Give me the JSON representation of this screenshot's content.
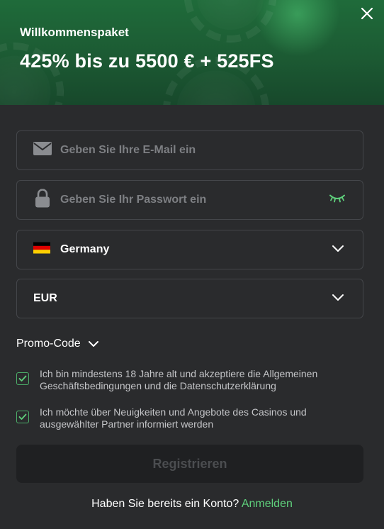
{
  "header": {
    "subtitle": "Willkommenspaket",
    "title": "425% bis zu 5500 € + 525FS",
    "close_icon": "close-icon"
  },
  "form": {
    "email": {
      "placeholder": "Geben Sie Ihre E-Mail ein",
      "value": "",
      "icon": "mail-icon"
    },
    "password": {
      "placeholder": "Geben Sie Ihr Passwort ein",
      "value": "",
      "icon": "lock-icon",
      "toggle_icon": "eye-closed-icon"
    },
    "country": {
      "value": "Germany",
      "icon": "germany-flag-icon"
    },
    "currency": {
      "value": "EUR"
    },
    "promo_label": "Promo-Code",
    "checkboxes": [
      {
        "label": "Ich bin mindestens 18 Jahre alt und akzeptiere die Allgemeinen Geschäftsbedingungen und die Datenschutzerklärung",
        "checked": true
      },
      {
        "label": "Ich möchte über Neuigkeiten und Angebote des Casinos und ausgewählter Partner informiert werden",
        "checked": true
      }
    ],
    "submit_label": "Registrieren"
  },
  "footer": {
    "prompt": "Haben Sie bereits ein Konto?",
    "login_label": "Anmelden"
  },
  "colors": {
    "accent": "#5fd07c",
    "background": "#2a2b2d",
    "header_green": "#1f6b3a"
  }
}
